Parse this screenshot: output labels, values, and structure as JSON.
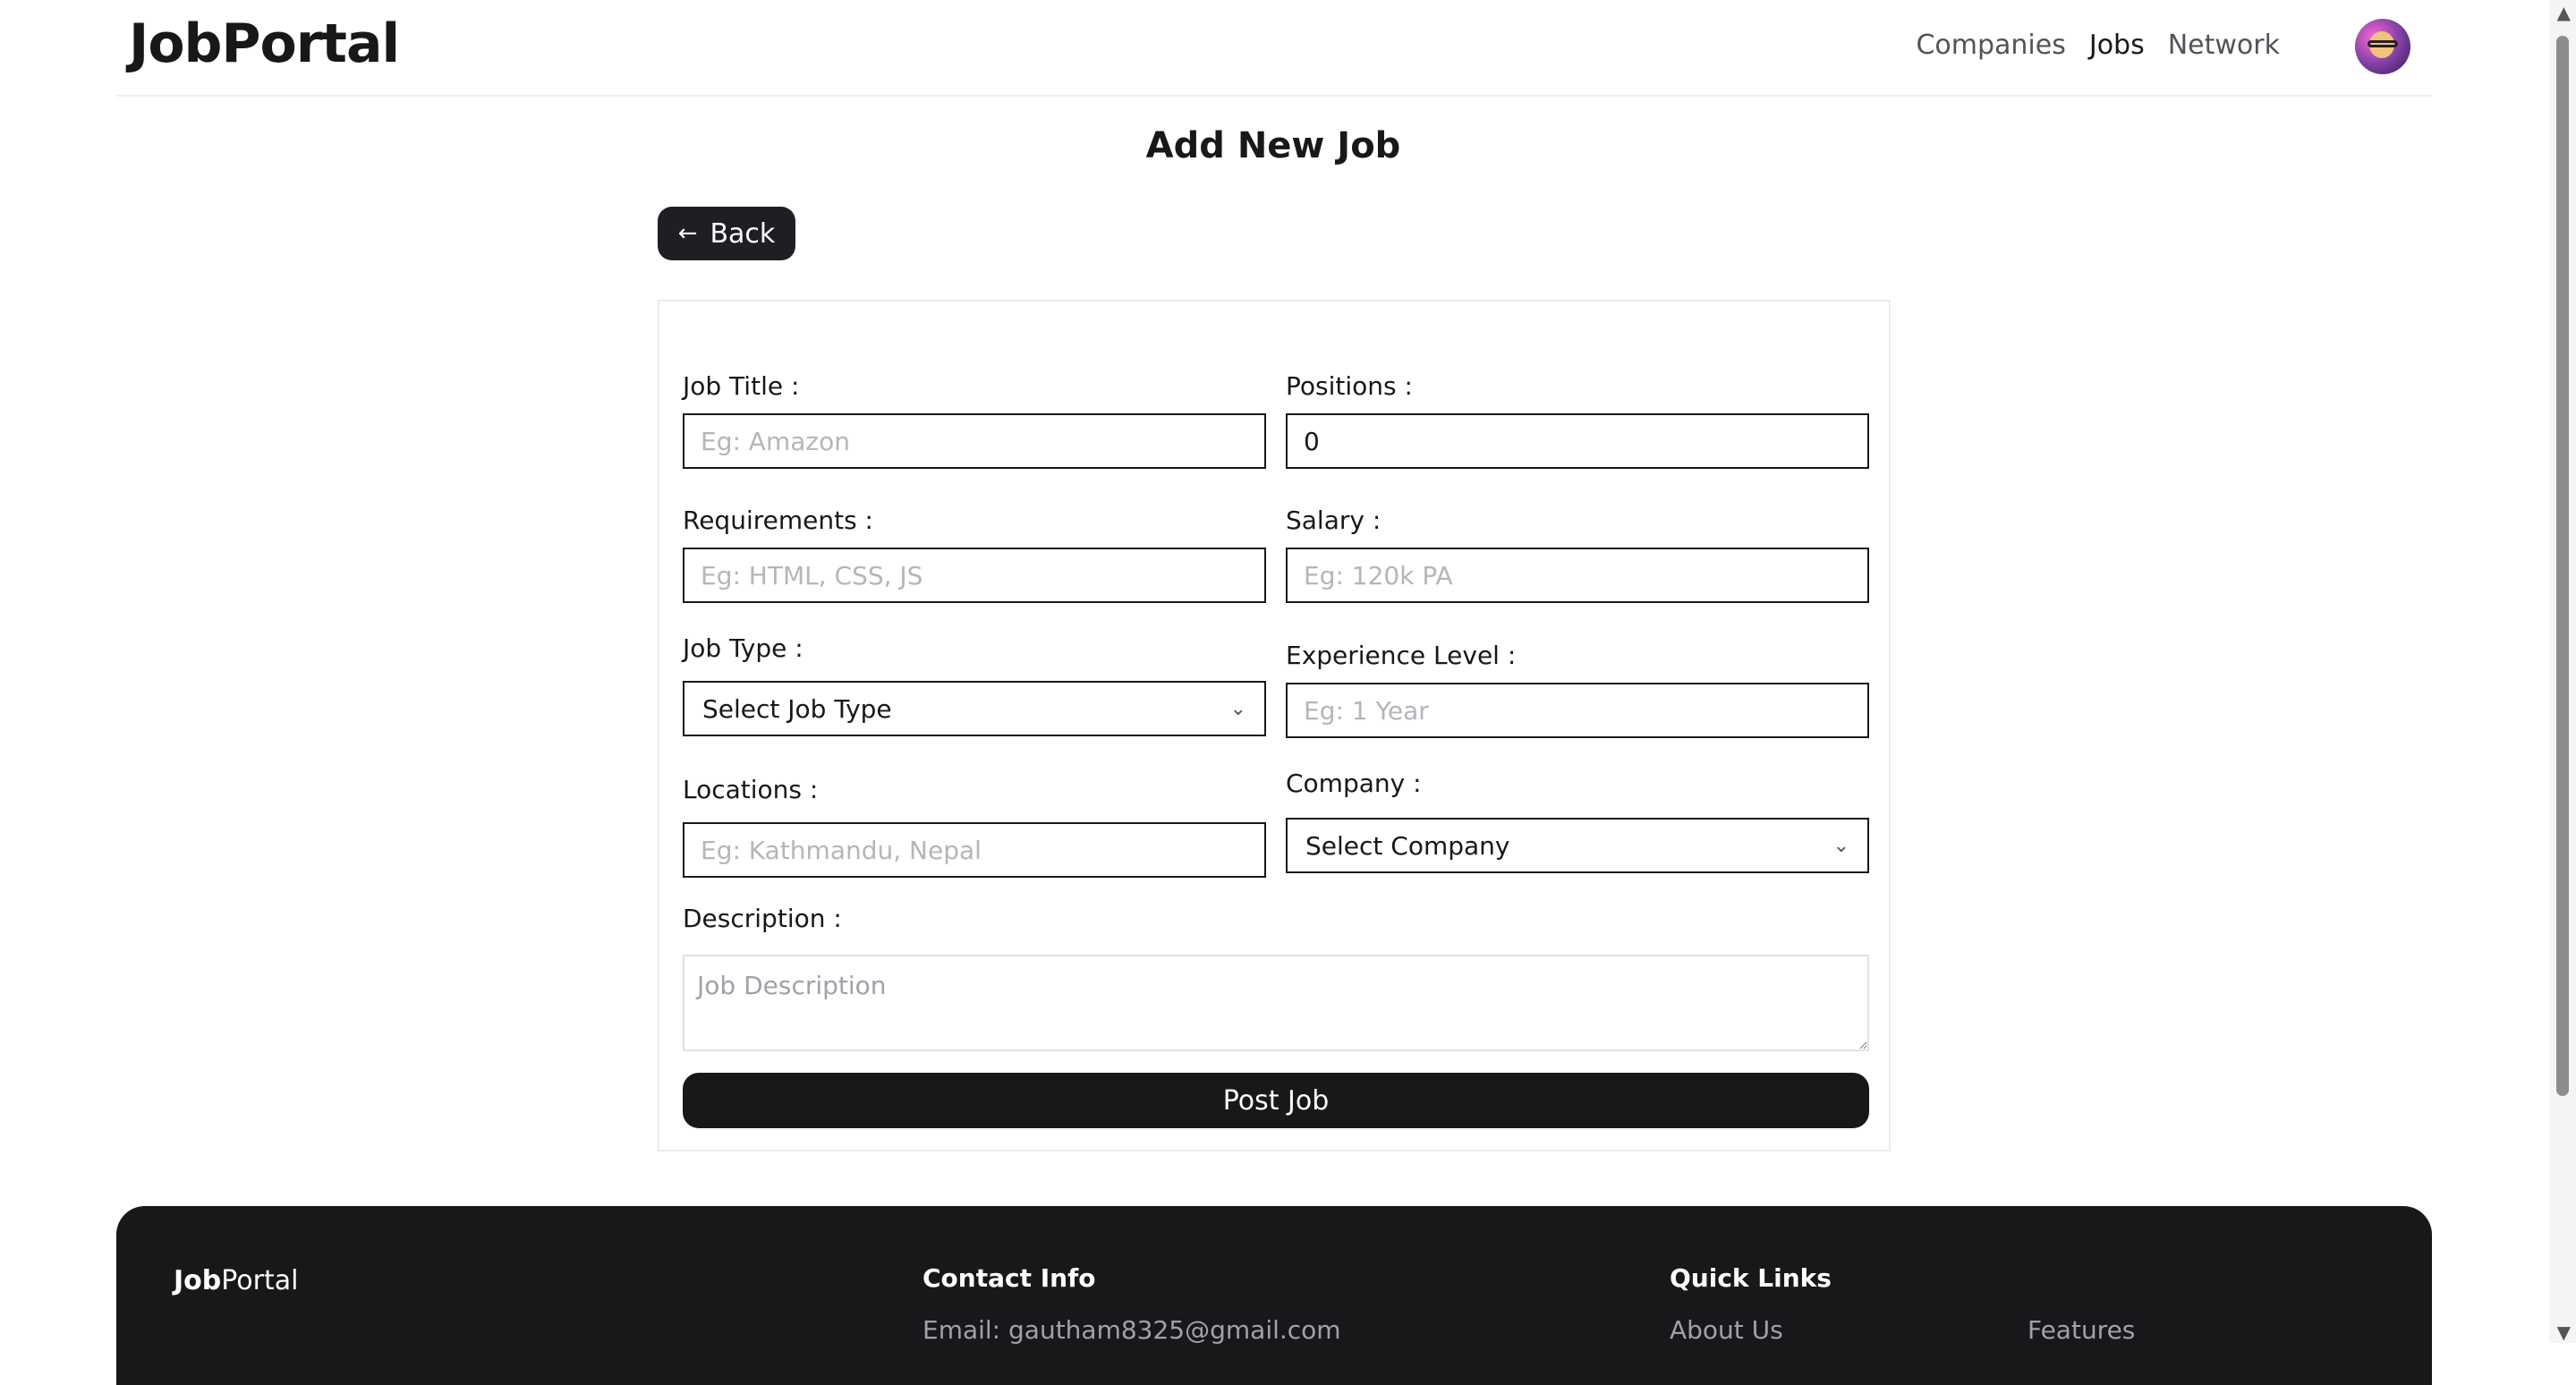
{
  "navbar": {
    "logo": "JobPortal",
    "links": [
      "Companies",
      "Jobs",
      "Network"
    ],
    "active_link": "Jobs"
  },
  "page": {
    "title": "Add New Job",
    "back_label": "Back"
  },
  "form": {
    "job_title": {
      "label": "Job Title :",
      "placeholder": "Eg: Amazon",
      "value": ""
    },
    "positions": {
      "label": "Positions :",
      "placeholder": "",
      "value": "0"
    },
    "requirements": {
      "label": "Requirements :",
      "placeholder": "Eg: HTML, CSS, JS",
      "value": ""
    },
    "salary": {
      "label": "Salary :",
      "placeholder": "Eg: 120k PA",
      "value": ""
    },
    "job_type": {
      "label": "Job Type :",
      "selected": "Select Job Type"
    },
    "experience": {
      "label": "Experience Level :",
      "placeholder": "Eg: 1 Year",
      "value": ""
    },
    "locations": {
      "label": "Locations :",
      "placeholder": "Eg: Kathmandu, Nepal",
      "value": ""
    },
    "company": {
      "label": "Company :",
      "selected": "Select Company"
    },
    "description": {
      "label": "Description :",
      "placeholder": "Job Description"
    },
    "submit_label": "Post Job"
  },
  "footer": {
    "logo_bold": "Job",
    "logo_rest": "Portal",
    "contact_title": "Contact Info",
    "contact_email": "Email: gautham8325@gmail.com",
    "links_title": "Quick Links",
    "links": [
      "About Us",
      "Features"
    ]
  },
  "colors": {
    "primary": "#18181b",
    "placeholder": "#b5b5bb",
    "border_light": "#ececec"
  },
  "icons": {
    "back": "arrow-left-icon",
    "dropdown": "chevron-down-icon"
  }
}
